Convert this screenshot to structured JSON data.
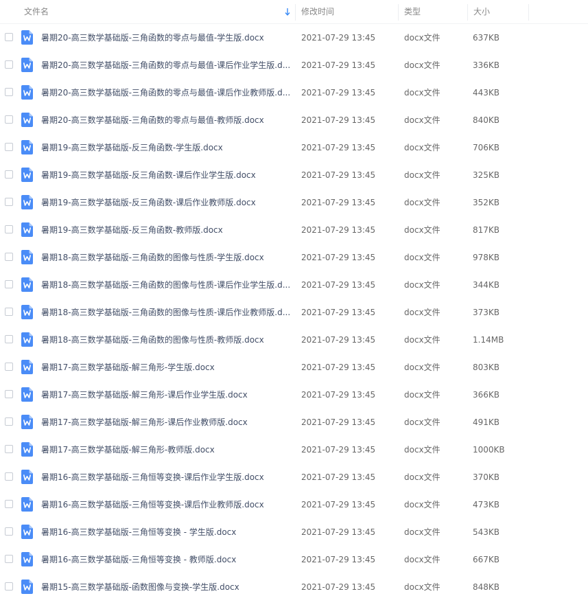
{
  "header": {
    "name": "文件名",
    "time": "修改时间",
    "type": "类型",
    "size": "大小"
  },
  "colors": {
    "icon_blue": "#4a8cf7",
    "sort_arrow": "#3b8cf5"
  },
  "files": [
    {
      "name": "暑期20-高三数学基础版-三角函数的零点与最值-学生版.docx",
      "time": "2021-07-29 13:45",
      "type": "docx文件",
      "size": "637KB"
    },
    {
      "name": "暑期20-高三数学基础版-三角函数的零点与最值-课后作业学生版.d...",
      "time": "2021-07-29 13:45",
      "type": "docx文件",
      "size": "336KB"
    },
    {
      "name": "暑期20-高三数学基础版-三角函数的零点与最值-课后作业教师版.d...",
      "time": "2021-07-29 13:45",
      "type": "docx文件",
      "size": "443KB"
    },
    {
      "name": "暑期20-高三数学基础版-三角函数的零点与最值-教师版.docx",
      "time": "2021-07-29 13:45",
      "type": "docx文件",
      "size": "840KB"
    },
    {
      "name": "暑期19-高三数学基础版-反三角函数-学生版.docx",
      "time": "2021-07-29 13:45",
      "type": "docx文件",
      "size": "706KB"
    },
    {
      "name": "暑期19-高三数学基础版-反三角函数-课后作业学生版.docx",
      "time": "2021-07-29 13:45",
      "type": "docx文件",
      "size": "325KB"
    },
    {
      "name": "暑期19-高三数学基础版-反三角函数-课后作业教师版.docx",
      "time": "2021-07-29 13:45",
      "type": "docx文件",
      "size": "352KB"
    },
    {
      "name": "暑期19-高三数学基础版-反三角函数-教师版.docx",
      "time": "2021-07-29 13:45",
      "type": "docx文件",
      "size": "817KB"
    },
    {
      "name": "暑期18-高三数学基础版-三角函数的图像与性质-学生版.docx",
      "time": "2021-07-29 13:45",
      "type": "docx文件",
      "size": "978KB"
    },
    {
      "name": "暑期18-高三数学基础版-三角函数的图像与性质-课后作业学生版.d...",
      "time": "2021-07-29 13:45",
      "type": "docx文件",
      "size": "344KB"
    },
    {
      "name": "暑期18-高三数学基础版-三角函数的图像与性质-课后作业教师版.d...",
      "time": "2021-07-29 13:45",
      "type": "docx文件",
      "size": "373KB"
    },
    {
      "name": "暑期18-高三数学基础版-三角函数的图像与性质-教师版.docx",
      "time": "2021-07-29 13:45",
      "type": "docx文件",
      "size": "1.14MB"
    },
    {
      "name": "暑期17-高三数学基础版-解三角形-学生版.docx",
      "time": "2021-07-29 13:45",
      "type": "docx文件",
      "size": "803KB"
    },
    {
      "name": "暑期17-高三数学基础版-解三角形-课后作业学生版.docx",
      "time": "2021-07-29 13:45",
      "type": "docx文件",
      "size": "366KB"
    },
    {
      "name": "暑期17-高三数学基础版-解三角形-课后作业教师版.docx",
      "time": "2021-07-29 13:45",
      "type": "docx文件",
      "size": "491KB"
    },
    {
      "name": "暑期17-高三数学基础版-解三角形-教师版.docx",
      "time": "2021-07-29 13:45",
      "type": "docx文件",
      "size": "1000KB"
    },
    {
      "name": "暑期16-高三数学基础版-三角恒等变换-课后作业学生版.docx",
      "time": "2021-07-29 13:45",
      "type": "docx文件",
      "size": "370KB"
    },
    {
      "name": "暑期16-高三数学基础版-三角恒等变换-课后作业教师版.docx",
      "time": "2021-07-29 13:45",
      "type": "docx文件",
      "size": "473KB"
    },
    {
      "name": "暑期16-高三数学基础版-三角恒等变换 - 学生版.docx",
      "time": "2021-07-29 13:45",
      "type": "docx文件",
      "size": "543KB"
    },
    {
      "name": "暑期16-高三数学基础版-三角恒等变换 - 教师版.docx",
      "time": "2021-07-29 13:45",
      "type": "docx文件",
      "size": "667KB"
    },
    {
      "name": "暑期15-高三数学基础版-函数图像与变换-学生版.docx",
      "time": "2021-07-29 13:45",
      "type": "docx文件",
      "size": "848KB"
    }
  ]
}
